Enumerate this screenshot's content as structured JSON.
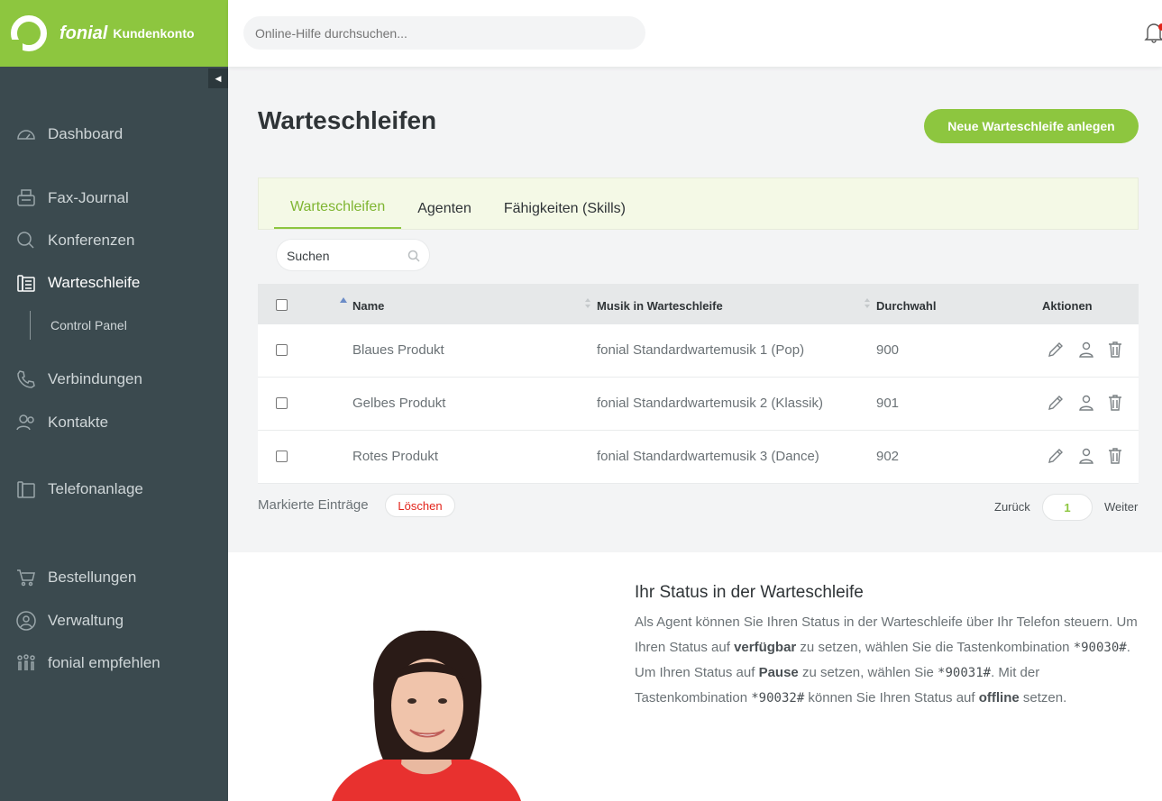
{
  "brand": {
    "name": "fonial",
    "subtitle": "Kundenkonto"
  },
  "sidebar": {
    "items": [
      {
        "label": "Dashboard"
      },
      {
        "label": "Fax-Journal"
      },
      {
        "label": "Konferenzen"
      },
      {
        "label": "Warteschleife",
        "active": true
      },
      {
        "label": "Verbindungen"
      },
      {
        "label": "Kontakte"
      },
      {
        "label": "Telefonanlage"
      },
      {
        "label": "Bestellungen"
      },
      {
        "label": "Verwaltung"
      },
      {
        "label": "fonial empfehlen"
      }
    ],
    "subitem": "Control Panel"
  },
  "header": {
    "search_placeholder": "Online-Hilfe durchsuchen..."
  },
  "page": {
    "title": "Warteschleifen",
    "new_button": "Neue Warteschleife anlegen"
  },
  "tabs": [
    {
      "label": "Warteschleifen",
      "active": true
    },
    {
      "label": "Agenten"
    },
    {
      "label": "Fähigkeiten (Skills)"
    }
  ],
  "table": {
    "search_placeholder": "Suchen",
    "columns": {
      "name": "Name",
      "music": "Musik in Warteschleife",
      "extension": "Durchwahl",
      "actions": "Aktionen"
    },
    "rows": [
      {
        "name": "Blaues Produkt",
        "music": "fonial Standardwartemusik 1 (Pop)",
        "extension": "900"
      },
      {
        "name": "Gelbes Produkt",
        "music": "fonial Standardwartemusik 2 (Klassik)",
        "extension": "901"
      },
      {
        "name": "Rotes Produkt",
        "music": "fonial Standardwartemusik 3 (Dance)",
        "extension": "902"
      }
    ]
  },
  "bulk": {
    "label": "Markierte Einträge",
    "delete": "Löschen"
  },
  "pagination": {
    "prev": "Zurück",
    "page": "1",
    "next": "Weiter"
  },
  "info": {
    "title": "Ihr Status in der Warteschleife",
    "t1": "Als Agent können Sie Ihren Status in der Warteschleife über Ihr Telefon steuern. Um Ihren Status auf ",
    "b1": "verfügbar",
    "t2": " zu setzen, wählen Sie die Tastenkombination ",
    "c1": "*90030#",
    "t3": ". Um Ihren Status auf ",
    "b2": "Pause",
    "t4": " zu setzen, wählen Sie ",
    "c2": "*90031#",
    "t5": ". Mit der Tastenkombination ",
    "c3": "*90032#",
    "t6": " können Sie Ihren Status auf ",
    "b3": "offline",
    "t7": " setzen."
  },
  "colors": {
    "brand_green": "#8dc63f",
    "sidebar_bg": "#3b4a4f",
    "danger": "#e2231a"
  }
}
